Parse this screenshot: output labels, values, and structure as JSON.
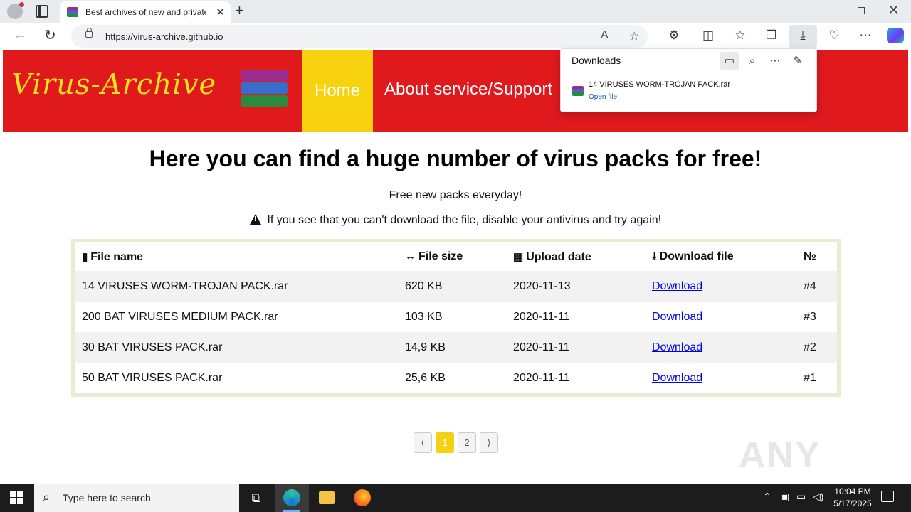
{
  "browser": {
    "tab_title": "Best archives of new and private",
    "url": "https://virus-archive.github.io"
  },
  "site": {
    "logo_text": "Virus-Archive",
    "nav": {
      "home": "Home",
      "about": "About service/Support"
    },
    "title": "Here you can find a huge number of virus packs for free!",
    "subtitle": "Free new packs everyday!",
    "warning": "If you see that you can't download the file, disable your antivirus and try again!",
    "table": {
      "headers": {
        "file_name": "File name",
        "file_size": "File size",
        "upload_date": "Upload date",
        "download_file": "Download file",
        "number": "№"
      },
      "rows": [
        {
          "name": "14 VIRUSES WORM-TROJAN PACK.rar",
          "size": "620 KB",
          "date": "2020-11-13",
          "link": "Download",
          "num": "#4"
        },
        {
          "name": "200 BAT VIRUSES MEDIUM PACK.rar",
          "size": "103 KB",
          "date": "2020-11-11",
          "link": "Download",
          "num": "#3"
        },
        {
          "name": "30 BAT VIRUSES PACK.rar",
          "size": "14,9 KB",
          "date": "2020-11-11",
          "link": "Download",
          "num": "#2"
        },
        {
          "name": "50 BAT VIRUSES PACK.rar",
          "size": "25,6 KB",
          "date": "2020-11-11",
          "link": "Download",
          "num": "#1"
        }
      ]
    },
    "pagination": {
      "prev": "⟨",
      "pages": [
        "1",
        "2"
      ],
      "next": "⟩",
      "current": "1"
    }
  },
  "downloads_panel": {
    "title": "Downloads",
    "file_name": "14 VIRUSES WORM-TROJAN PACK.rar",
    "open_file": "Open file"
  },
  "taskbar": {
    "search_placeholder": "Type here to search",
    "time": "10:04 PM",
    "date": "5/17/2025"
  },
  "watermark": "ANY RUN",
  "colors": {
    "header_red": "#e0191d",
    "home_yellow": "#f9d20f",
    "logo_yellow": "#f2e21f",
    "link_blue": "#0000ee"
  }
}
